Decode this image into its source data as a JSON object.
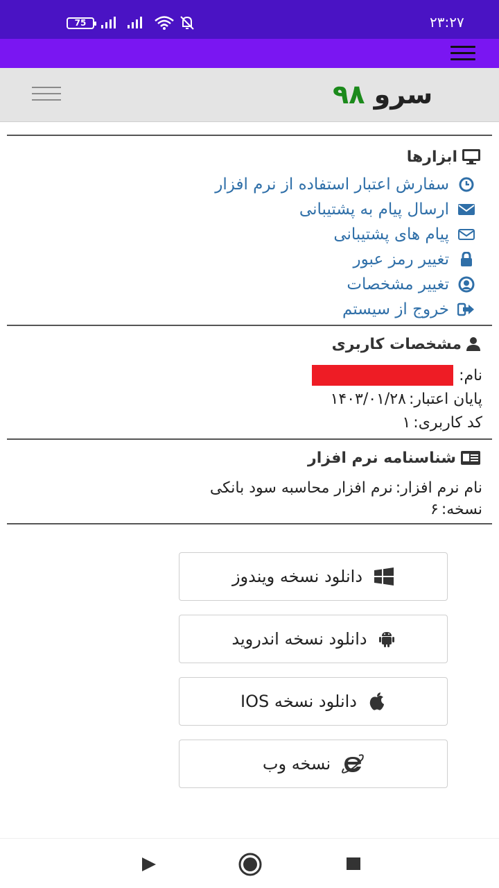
{
  "status_bar": {
    "battery": "75",
    "time": "۲۳:۲۷",
    "icons": [
      "battery-icon",
      "signal-icon",
      "signal-icon",
      "wifi-icon",
      "bell-off-icon"
    ]
  },
  "app_bar": {
    "menu_icon": "hamburger-icon"
  },
  "header": {
    "logo_part1": "سرو",
    "logo_part2": "۹۸",
    "nav_toggle_icon": "hamburger-icon"
  },
  "tools": {
    "title": "ابزارها",
    "icon": "monitor-icon",
    "items": [
      {
        "label": "سفارش اعتبار استفاده از نرم افزار",
        "icon": "clock-icon"
      },
      {
        "label": "ارسال پیام به پشتیبانی",
        "icon": "envelope-icon"
      },
      {
        "label": "پیام های پشتیبانی",
        "icon": "envelope-outline-icon"
      },
      {
        "label": "تغییر رمز عبور",
        "icon": "lock-icon"
      },
      {
        "label": "تغییر مشخصات",
        "icon": "user-circle-icon"
      },
      {
        "label": "خروج از سیستم",
        "icon": "sign-out-icon"
      }
    ]
  },
  "user_info": {
    "title": "مشخصات کاربری",
    "icon": "user-icon",
    "name_label": "نام:",
    "expiry_label": "پایان اعتبار:",
    "expiry_value": "۱۴۰۳/۰۱/۲۸",
    "user_code_label": "کد کاربری:",
    "user_code_value": "۱"
  },
  "software": {
    "title": "شناسنامه نرم افزار",
    "icon": "id-card-icon",
    "name_label": "نام نرم افزار:",
    "name_value": "نرم افزار محاسبه سود بانکی",
    "version_label": "نسخه:",
    "version_value": "۶"
  },
  "downloads": [
    {
      "label": "دانلود نسخه ویندوز",
      "icon": "windows-icon"
    },
    {
      "label": "دانلود نسخه اندروید",
      "icon": "android-icon"
    },
    {
      "label": "دانلود نسخه IOS",
      "icon": "apple-icon"
    },
    {
      "label": "نسخه وب",
      "icon": "internet-explorer-icon"
    }
  ],
  "colors": {
    "status_bar": "#4a13c4",
    "app_bar": "#7a16f2",
    "link": "#2f6fa8",
    "logo_green": "#1b8a1b",
    "redacted": "#ee1c25"
  }
}
